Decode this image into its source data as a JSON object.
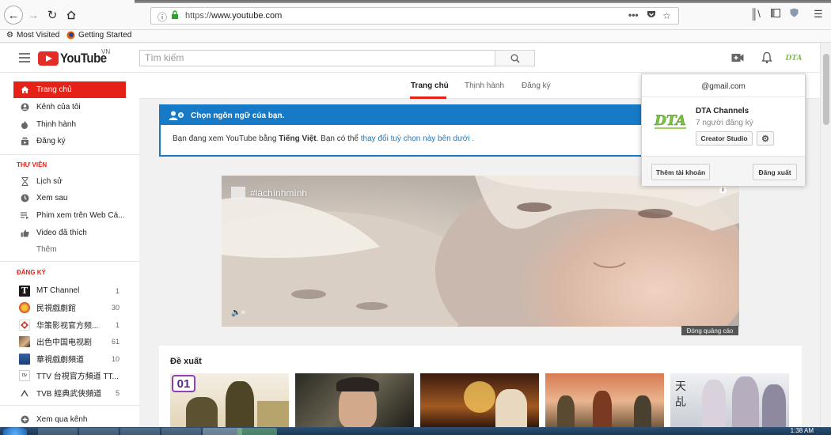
{
  "browser": {
    "url_scheme": "https://",
    "url_domain": "www.youtube.com",
    "url_overflow": "•••",
    "bookmarks": [
      "Most Visited",
      "Getting Started"
    ]
  },
  "masthead": {
    "logo_text": "YouTube",
    "country": "VN",
    "search_placeholder": "Tìm kiếm"
  },
  "sidebar": {
    "items": [
      {
        "label": "Trang chủ",
        "icon": "home-icon"
      },
      {
        "label": "Kênh của tôi",
        "icon": "account-icon"
      },
      {
        "label": "Thịnh hành",
        "icon": "flame-icon"
      },
      {
        "label": "Đăng ký",
        "icon": "subscriptions-icon"
      }
    ],
    "library_title": "THƯ VIỆN",
    "library": [
      {
        "label": "Lịch sử",
        "icon": "hourglass-icon"
      },
      {
        "label": "Xem sau",
        "icon": "clock-icon"
      },
      {
        "label": "Phim xem trên Web Cá...",
        "icon": "playlist-icon"
      },
      {
        "label": "Video đã thích",
        "icon": "thumbs-up-icon"
      },
      {
        "label": "Thêm",
        "icon": ""
      }
    ],
    "subs_title": "ĐĂNG KÝ",
    "subscriptions": [
      {
        "label": "MT Channel",
        "count": "1"
      },
      {
        "label": "民視戲劇館",
        "count": "30"
      },
      {
        "label": "华策影视官方频...",
        "count": "1"
      },
      {
        "label": "出色中国电视剧",
        "count": "61"
      },
      {
        "label": "華視戲劇頻道",
        "count": "10"
      },
      {
        "label": "TTV 台視官方頻道 TT...",
        "count": ""
      },
      {
        "label": "TVB 經典武俠頻道",
        "count": "5"
      }
    ],
    "browse_channels": "Xem qua kênh"
  },
  "tabs": [
    "Trang chủ",
    "Thịnh hành",
    "Đăng ký"
  ],
  "banner": {
    "title": "Chọn ngôn ngữ của bạn.",
    "text_before": "Bạn đang xem YouTube bằng ",
    "language": "Tiếng Việt",
    "text_mid": ". Bạn có thể ",
    "link": "thay đổi tuỳ chọn này bên dưới",
    "text_after": " ."
  },
  "video": {
    "hashtag": "#làchínhmình",
    "ad_label": "Đóng quảng cáo"
  },
  "recommended": {
    "title": "Đề xuất",
    "first_badge": "01"
  },
  "account": {
    "email": "@gmail.com",
    "channel_name": "DTA Channels",
    "subscribers": "7 người đăng ký",
    "creator_studio": "Creator Studio",
    "add_account": "Thêm tài khoản",
    "sign_out": "Đăng xuất",
    "avatar_text": "DTA"
  },
  "taskbar": {
    "time": "1:38 AM"
  },
  "colors": {
    "youtube_red": "#e62117",
    "banner_blue": "#167ac6"
  }
}
